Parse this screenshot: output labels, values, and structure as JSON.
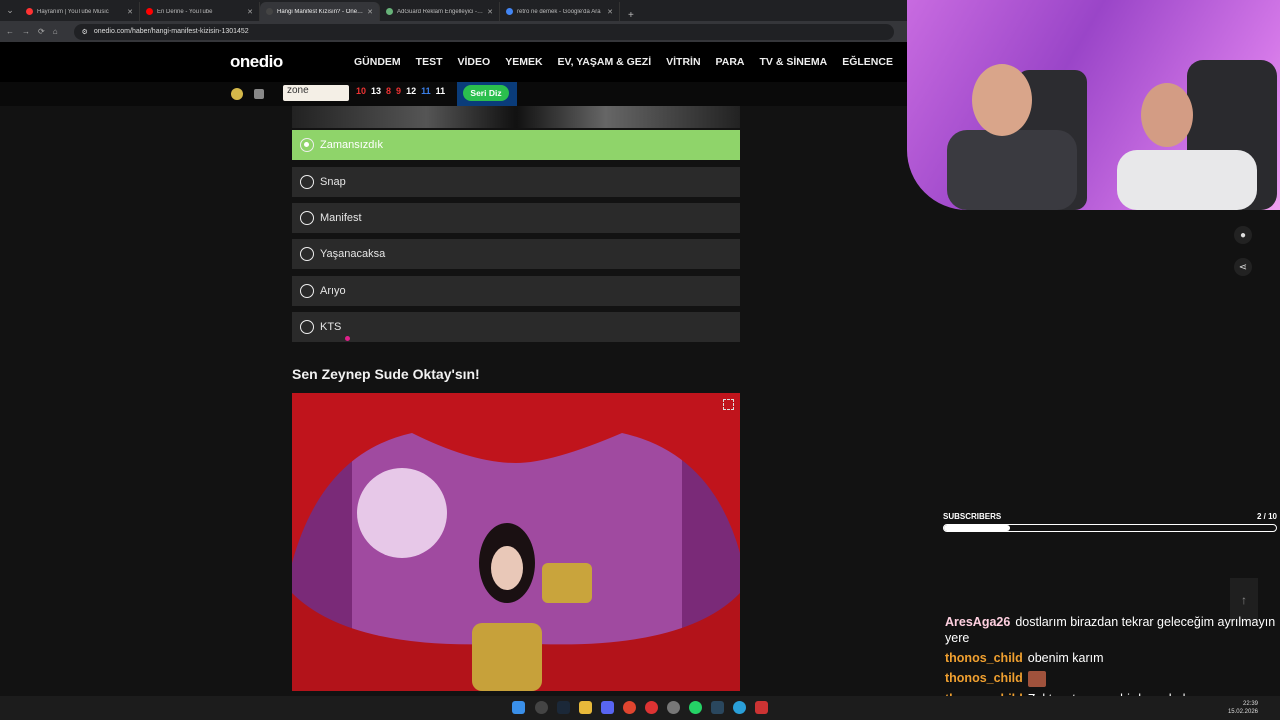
{
  "browser": {
    "tabs": [
      {
        "title": "Hayranım | YouTube Music",
        "color": "#ff3333",
        "active": false
      },
      {
        "title": "En Derine - YouTube",
        "color": "#ff0000",
        "active": false
      },
      {
        "title": "Hangi Manifest Kızısın? - Onedio",
        "color": "#444444",
        "active": true
      },
      {
        "title": "AdGuard Reklam Engelleyici - Google",
        "color": "#67b279",
        "active": false
      },
      {
        "title": "retro ne demek - Google'da Ara",
        "color": "#4285f4",
        "active": false
      }
    ],
    "url": "onedio.com/haber/hangi-manifest-kizisin-1301452"
  },
  "site": {
    "logo": "onedio",
    "nav": [
      "GÜNDEM",
      "TEST",
      "VİDEO",
      "YEMEK",
      "EV, YAŞAM & GEZİ",
      "VİTRİN",
      "PARA",
      "TV & SİNEMA",
      "EĞLENCE",
      "BİLGİ"
    ],
    "zone_label": "zone",
    "scores": [
      "10",
      "13",
      "8",
      "9",
      "12",
      "11",
      "11"
    ],
    "seri_label": "Seri Diz"
  },
  "quiz": {
    "options": [
      {
        "label": "Zamansızdık",
        "selected": true
      },
      {
        "label": "Snap",
        "selected": false
      },
      {
        "label": "Manifest",
        "selected": false
      },
      {
        "label": "Yaşanacaksa",
        "selected": false
      },
      {
        "label": "Arıyo",
        "selected": false
      },
      {
        "label": "KTS",
        "selected": false
      }
    ],
    "result_title": "Sen Zeynep Sude Oktay'sın!"
  },
  "stream": {
    "subs_label": "SUBSCRIBERS",
    "subs_count": "2 / 10",
    "subs_progress": 0.2,
    "chat": [
      {
        "user": "AresAga26",
        "color": "#ffd0e0",
        "text": "dostlarım birazdan tekrar geleceğim ayrılmayın",
        "text2": "yere"
      },
      {
        "user": "thonos_child",
        "color": "#f0a030",
        "text": "obenim karım"
      },
      {
        "user": "thonos_child",
        "color": "#f0a030",
        "text": "",
        "emote": true
      },
      {
        "user": "thonos_child",
        "color": "#f0a030",
        "text": "Zoktayı tanıyom birde sudeda"
      }
    ]
  },
  "taskbar": {
    "time": "22:39",
    "date": "15.02.2026"
  }
}
